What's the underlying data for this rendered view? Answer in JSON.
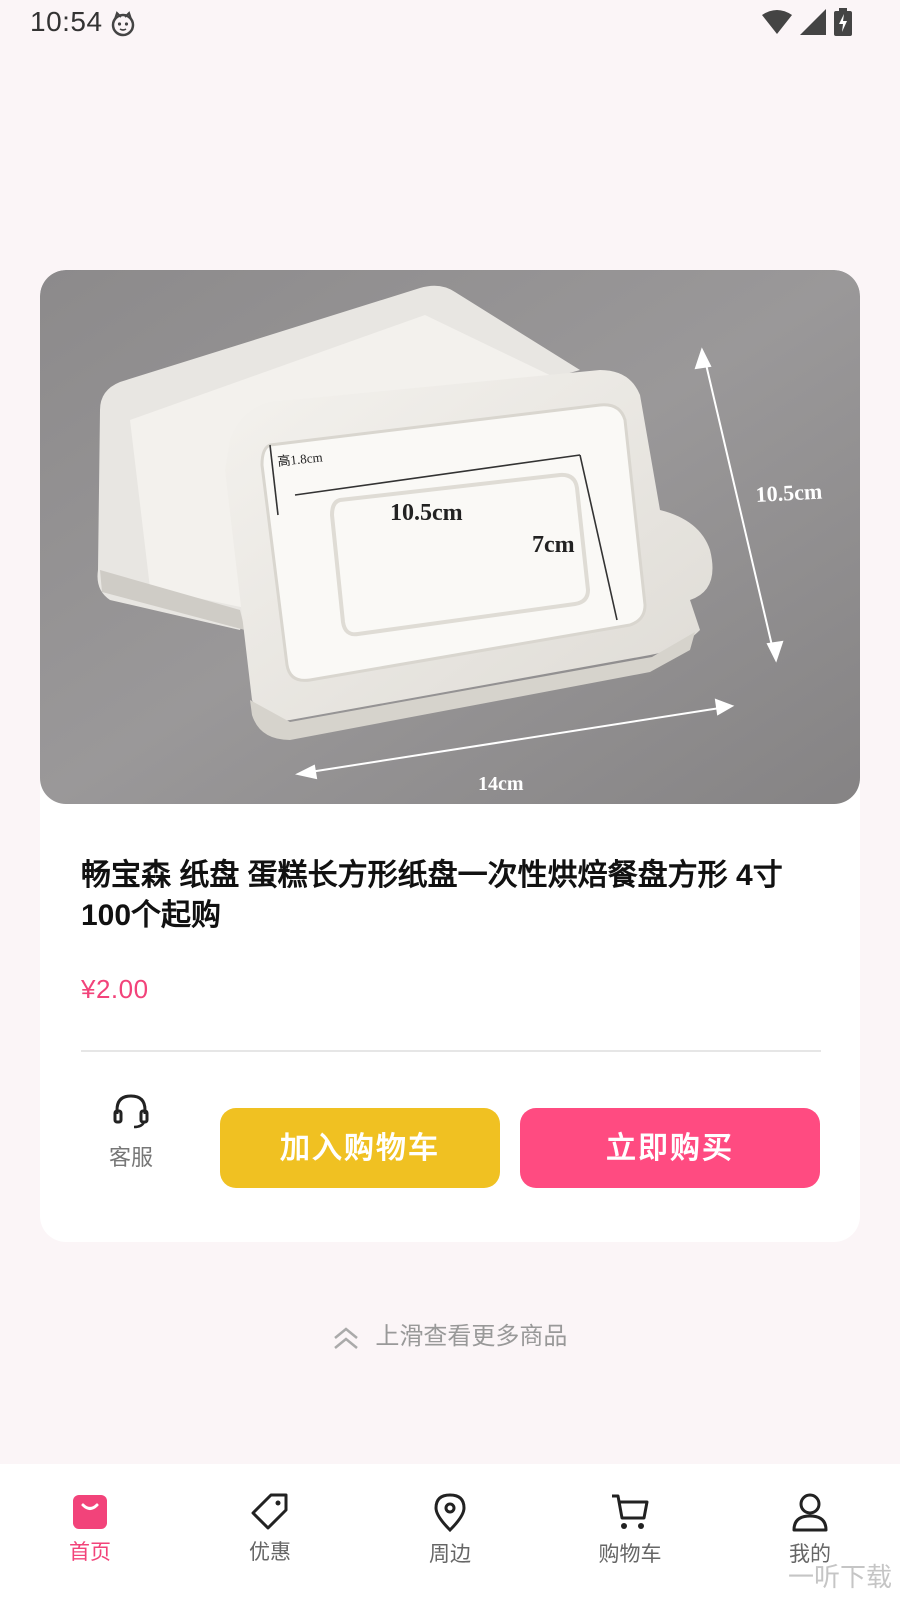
{
  "status_bar": {
    "time": "10:54"
  },
  "product": {
    "image_labels": {
      "height": "高1.8cm",
      "inner_width": "10.5cm",
      "inner_depth": "7cm",
      "outer_depth": "10.5cm",
      "outer_width": "14cm"
    },
    "title": "畅宝森 纸盘 蛋糕长方形纸盘一次性烘焙餐盘方形 4寸 100个起购",
    "price": "¥2.00"
  },
  "actions": {
    "service_label": "客服",
    "add_to_cart_label": "加入购物车",
    "buy_now_label": "立即购买"
  },
  "swipe_hint": "上滑查看更多商品",
  "tabs": [
    {
      "label": "首页",
      "icon": "home-bag-icon",
      "active": true
    },
    {
      "label": "优惠",
      "icon": "tag-icon",
      "active": false
    },
    {
      "label": "周边",
      "icon": "location-pin-icon",
      "active": false
    },
    {
      "label": "购物车",
      "icon": "cart-icon",
      "active": false
    },
    {
      "label": "我的",
      "icon": "user-icon",
      "active": false
    }
  ],
  "watermark": "一听下载",
  "colors": {
    "accent": "#f2437a",
    "cart_button": "#f0c122",
    "buy_button": "#ff4b81",
    "background": "#fbf5f7"
  }
}
